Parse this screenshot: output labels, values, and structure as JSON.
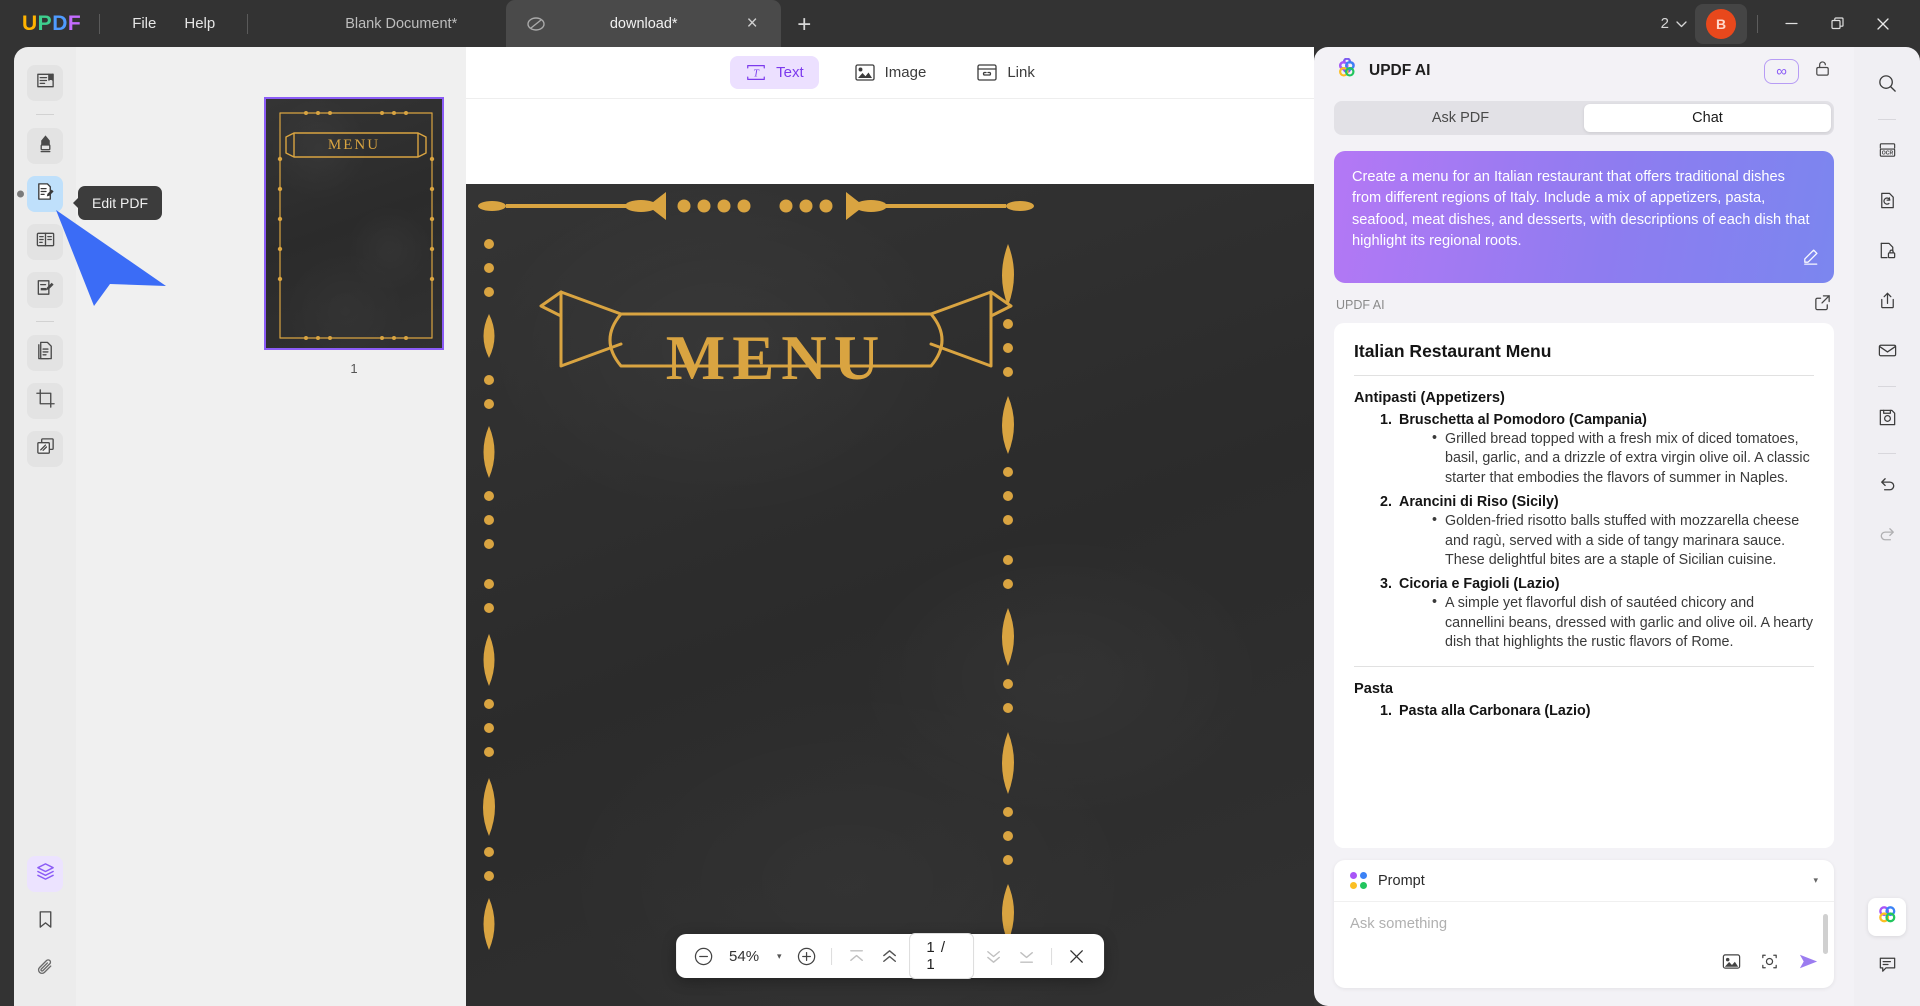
{
  "titlebar": {
    "logo": "UPDF",
    "menus": [
      "File",
      "Help"
    ],
    "tabs": [
      {
        "label": "Blank Document*",
        "active": false
      },
      {
        "label": "download*",
        "active": true
      }
    ],
    "new_tab_label": "+",
    "window_count": "2",
    "avatar_initial": "B",
    "window_buttons": [
      "minimize-icon",
      "restore-icon",
      "close-icon"
    ]
  },
  "left_rail": {
    "items": [
      {
        "name": "reader-mode",
        "icon": "book-reader-icon"
      },
      {
        "name": "highlight-markup",
        "icon": "marker-pen-icon"
      },
      {
        "name": "edit-pdf",
        "icon": "edit-pdf-icon",
        "active": true
      },
      {
        "name": "organize-pages",
        "icon": "page-organize-icon"
      },
      {
        "name": "annotate",
        "icon": "annotate-pen-icon"
      },
      {
        "name": "convert-pdf",
        "icon": "convert-doc-icon"
      },
      {
        "name": "crop-page",
        "icon": "crop-icon"
      },
      {
        "name": "batch-process",
        "icon": "batch-pages-icon"
      }
    ],
    "bottom_items": [
      {
        "name": "layers",
        "icon": "layers-icon",
        "active": true
      },
      {
        "name": "bookmarks",
        "icon": "bookmark-icon"
      },
      {
        "name": "attachments",
        "icon": "paperclip-icon"
      }
    ]
  },
  "tooltip": {
    "text": "Edit PDF"
  },
  "thumbnails": {
    "pages": [
      {
        "number": "1",
        "title": "MENU"
      }
    ]
  },
  "edit_toolbar": {
    "items": [
      {
        "label": "Text",
        "icon": "text-tool-icon",
        "active": true
      },
      {
        "label": "Image",
        "icon": "image-tool-icon",
        "active": false
      },
      {
        "label": "Link",
        "icon": "link-tool-icon",
        "active": false
      }
    ]
  },
  "document": {
    "banner_title": "MENU"
  },
  "page_nav": {
    "zoom_out": "zoom-out-icon",
    "zoom_level": "54%",
    "zoom_dropdown": "▾",
    "zoom_in": "zoom-in-icon",
    "first_page": "first-page-icon",
    "prev_page": "prev-page-icon",
    "page_indicator": "1 / 1",
    "next_page": "next-page-icon",
    "last_page": "last-page-icon",
    "close": "close-icon"
  },
  "ai_panel": {
    "title": "UPDF AI",
    "logo_icon": "updf-ai-flower-icon",
    "infinity_badge": "∞",
    "unlock_icon": "unlock-icon",
    "tabs": [
      {
        "label": "Ask PDF",
        "active": false
      },
      {
        "label": "Chat",
        "active": true
      }
    ],
    "prompt_bubble": {
      "text": "Create a menu for an Italian restaurant that offers traditional dishes from different regions of Italy. Include a mix of appetizers, pasta, seafood, meat dishes, and desserts, with descriptions of each dish that highlight its regional roots.",
      "edit_icon": "pencil-edit-icon"
    },
    "source_label": "UPDF AI",
    "open_external_icon": "open-external-icon",
    "answer": {
      "title": "Italian Restaurant Menu",
      "sections": [
        {
          "heading": "Antipasti (Appetizers)",
          "items": [
            {
              "num": "1.",
              "name": "Bruschetta al Pomodoro (Campania)",
              "desc": "Grilled bread topped with a fresh mix of diced tomatoes, basil, garlic, and a drizzle of extra virgin olive oil. A classic starter that embodies the flavors of summer in Naples."
            },
            {
              "num": "2.",
              "name": "Arancini di Riso (Sicily)",
              "desc": "Golden-fried risotto balls stuffed with mozzarella cheese and ragù, served with a side of tangy marinara sauce. These delightful bites are a staple of Sicilian cuisine."
            },
            {
              "num": "3.",
              "name": "Cicoria e Fagioli (Lazio)",
              "desc": "A simple yet flavorful dish of sautéed chicory and cannellini beans, dressed with garlic and olive oil. A hearty dish that highlights the rustic flavors of Rome."
            }
          ]
        },
        {
          "heading": "Pasta",
          "items": [
            {
              "num": "1.",
              "name": "Pasta alla Carbonara (Lazio)",
              "desc": ""
            }
          ]
        }
      ]
    },
    "composer": {
      "mode_label": "Prompt",
      "mode_icon": "four-dots-icon",
      "caret": "▾",
      "placeholder": "Ask something",
      "actions": [
        "insert-image-icon",
        "screenshot-icon",
        "send-icon"
      ]
    }
  },
  "right_rail": {
    "items": [
      {
        "name": "search",
        "icon": "search-icon"
      },
      {
        "name": "ocr",
        "icon": "ocr-icon"
      },
      {
        "name": "convert",
        "icon": "convert-icon"
      },
      {
        "name": "protect",
        "icon": "lock-document-icon"
      },
      {
        "name": "share",
        "icon": "share-icon"
      },
      {
        "name": "email",
        "icon": "envelope-icon"
      },
      {
        "name": "save",
        "icon": "save-disk-icon"
      },
      {
        "name": "undo",
        "icon": "undo-icon"
      },
      {
        "name": "redo",
        "icon": "redo-icon"
      }
    ],
    "bottom_items": [
      {
        "name": "updf-ai",
        "icon": "updf-ai-flower-icon",
        "active": true
      },
      {
        "name": "comments",
        "icon": "comment-bubble-icon"
      }
    ]
  },
  "colors": {
    "brand_purple": "#8b5cf6",
    "accent_blue": "#3b6cf6",
    "titlebar": "#333333",
    "avatar": "#e8481c",
    "menu_gold": "#d9a441"
  }
}
